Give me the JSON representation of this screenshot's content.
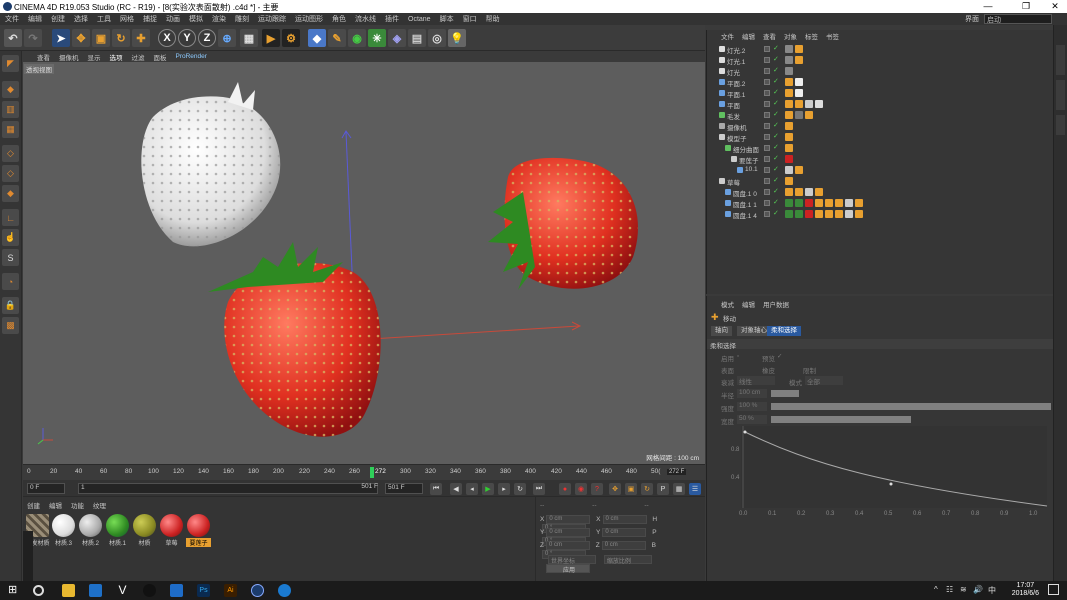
{
  "title": "CINEMA 4D R19.053 Studio (RC - R19) - [8(实验次表面散射) .c4d *] - 主要",
  "window_controls": [
    "—",
    "❐",
    "✕"
  ],
  "menu": [
    "文件",
    "编辑",
    "创建",
    "选择",
    "工具",
    "网格",
    "捕捉",
    "动画",
    "模拟",
    "渲染",
    "雕刻",
    "运动跟踪",
    "运动图形",
    "角色",
    "流水线",
    "插件",
    "Octane",
    "脚本",
    "窗口",
    "帮助"
  ],
  "layout_label": "界面",
  "layout_value": "启动",
  "viewport_menu": [
    "查看",
    "摄像机",
    "显示",
    "选项",
    "过滤",
    "面板",
    "ProRender"
  ],
  "viewport_label": "透视视图",
  "grid_spacing": "网格间距 : 100 cm",
  "timeline_ticks": [
    "0",
    "20",
    "40",
    "60",
    "80",
    "100",
    "120",
    "140",
    "160",
    "180",
    "200",
    "220",
    "240",
    "260",
    "280",
    "300",
    "320",
    "340",
    "360",
    "380",
    "400",
    "420",
    "440",
    "460",
    "480",
    "50("
  ],
  "timeline_current": "272",
  "timeline_frame": "272 F",
  "play_start": "0 F",
  "play_current": "1",
  "play_end_a": "501 F",
  "play_end_b": "501 F",
  "mat_menu": [
    "创建",
    "编辑",
    "功能",
    "纹理"
  ],
  "materials": [
    {
      "label": "混发材质",
      "color": "#8a8070",
      "kind": "stripe"
    },
    {
      "label": "材质.3",
      "color": "#f0f0f0",
      "kind": "ball"
    },
    {
      "label": "材质.2",
      "color": "#b0b0b0",
      "kind": "ball"
    },
    {
      "label": "材质.1",
      "color": "#2f8a22",
      "kind": "ball"
    },
    {
      "label": "材质",
      "color": "#8a8a22",
      "kind": "ball"
    },
    {
      "label": "草莓",
      "color": "#cc2222",
      "kind": "ball"
    },
    {
      "label": "要莲子",
      "color": "#cc2222",
      "kind": "ball",
      "selected": true
    }
  ],
  "coords": {
    "header": [
      "--",
      "--",
      "--"
    ],
    "rows": [
      [
        "X",
        "0 cm",
        "X",
        "0 cm",
        "H",
        "0 °"
      ],
      [
        "Y",
        "0 cm",
        "Y",
        "0 cm",
        "P",
        "0 °"
      ],
      [
        "Z",
        "0 cm",
        "Z",
        "0 cm",
        "B",
        "0 °"
      ]
    ],
    "mode1": "世界坐标",
    "mode2": "缩放比例",
    "apply": "应用"
  },
  "obj_menu": [
    "文件",
    "编辑",
    "查看",
    "对象",
    "标签",
    "书签"
  ],
  "objects": [
    {
      "name": "灯光.2",
      "indent": 0,
      "icon": "#ddd"
    },
    {
      "name": "灯光.1",
      "indent": 0,
      "icon": "#ddd"
    },
    {
      "name": "灯光",
      "indent": 0,
      "icon": "#ddd"
    },
    {
      "name": "平面.2",
      "indent": 0,
      "icon": "#6aa0e0"
    },
    {
      "name": "平面.1",
      "indent": 0,
      "icon": "#6aa0e0"
    },
    {
      "name": "平面",
      "indent": 0,
      "icon": "#6aa0e0"
    },
    {
      "name": "毛发",
      "indent": 0,
      "icon": "#60c060"
    },
    {
      "name": "摄像机",
      "indent": 0,
      "icon": "#aaa"
    },
    {
      "name": "模型子",
      "indent": 0,
      "icon": "#ccc"
    },
    {
      "name": "细分曲面",
      "indent": 1,
      "icon": "#60c060"
    },
    {
      "name": "要莲子",
      "indent": 2,
      "icon": "#ccc"
    },
    {
      "name": "10.1",
      "indent": 3,
      "icon": "#6aa0e0"
    },
    {
      "name": "草莓",
      "indent": 0,
      "icon": "#ccc"
    },
    {
      "name": "圆盘.1 0",
      "indent": 1,
      "icon": "#6aa0e0"
    },
    {
      "name": "圆盘.1 1",
      "indent": 1,
      "icon": "#6aa0e0"
    },
    {
      "name": "圆盘.1 4",
      "indent": 1,
      "icon": "#6aa0e0"
    }
  ],
  "attr_menu": [
    "模式",
    "编辑",
    "用户数据"
  ],
  "attr_title": "移动",
  "attr_tabs": [
    "轴向",
    "对象轴心",
    "柔和选择"
  ],
  "attr_section": "柔和选择",
  "attr_fields": {
    "enable": "启用",
    "preview": "预览",
    "surface": "表面",
    "rubber": "橡皮",
    "restrict": "限制",
    "falloff": "衰减",
    "falloff_val": "线性",
    "mode": "模式",
    "mode_val": "全部",
    "radius": "半径",
    "radius_val": "100 cm",
    "strength": "强度",
    "strength_val": "100 %",
    "width": "宽度",
    "width_val": "50 %"
  },
  "curve_y": [
    "0.8",
    "0.4"
  ],
  "curve_x": [
    "0.0",
    "0.1",
    "0.2",
    "0.3",
    "0.4",
    "0.5",
    "0.6",
    "0.7",
    "0.8",
    "0.9",
    "1.0"
  ],
  "clock_time": "17:07",
  "clock_date": "2018/6/6",
  "tray_lang": "中"
}
